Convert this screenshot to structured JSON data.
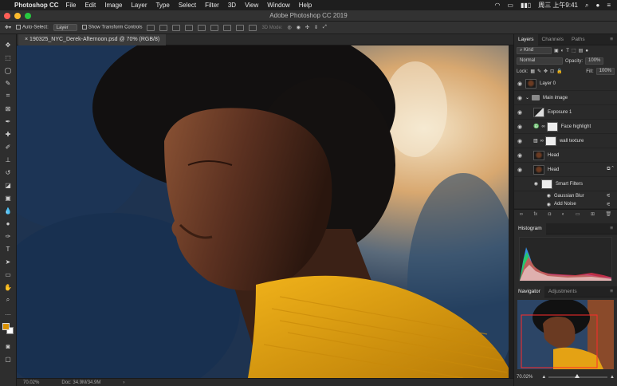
{
  "menubar": {
    "app": "Photoshop CC",
    "items": [
      "File",
      "Edit",
      "Image",
      "Layer",
      "Type",
      "Select",
      "Filter",
      "3D",
      "View",
      "Window",
      "Help"
    ],
    "clock": "周三 上午9:41"
  },
  "window": {
    "title": "Adobe Photoshop CC 2019"
  },
  "options": {
    "auto_select": "Auto-Select:",
    "auto_select_target": "Layer",
    "transform_controls": "Show Transform Controls",
    "mode_3d": "3D Mode:"
  },
  "document": {
    "tab_title": "190325_NYC_Derek-Afternoon.psd @ 70% (RGB/8)"
  },
  "status": {
    "zoom": "70.02%",
    "doc": "Doc: 34.9M/34.9M"
  },
  "panels": {
    "layers_tabs": [
      "Layers",
      "Channels",
      "Paths"
    ],
    "filter_kind": "Kind",
    "blend_mode": "Normal",
    "opacity_label": "Opacity:",
    "opacity_value": "100%",
    "lock_label": "Lock:",
    "fill_label": "Fill:",
    "fill_value": "100%",
    "layers": [
      {
        "name": "Layer 0"
      },
      {
        "name": "Main image"
      },
      {
        "name": "Exposure 1"
      },
      {
        "name": "Face highlight"
      },
      {
        "name": "wall texture"
      },
      {
        "name": "Head"
      },
      {
        "name": "Head"
      },
      {
        "name": "Smart Filters"
      },
      {
        "name": "Gaussian Blur"
      },
      {
        "name": "Add Noise"
      }
    ],
    "histogram_tab": "Histogram",
    "navigator_tabs": [
      "Navigator",
      "Adjustments"
    ],
    "nav_zoom": "70.02%"
  },
  "colors": {
    "foreground": "#d99100",
    "background": "#ffffff",
    "accent": "#e59a00"
  }
}
